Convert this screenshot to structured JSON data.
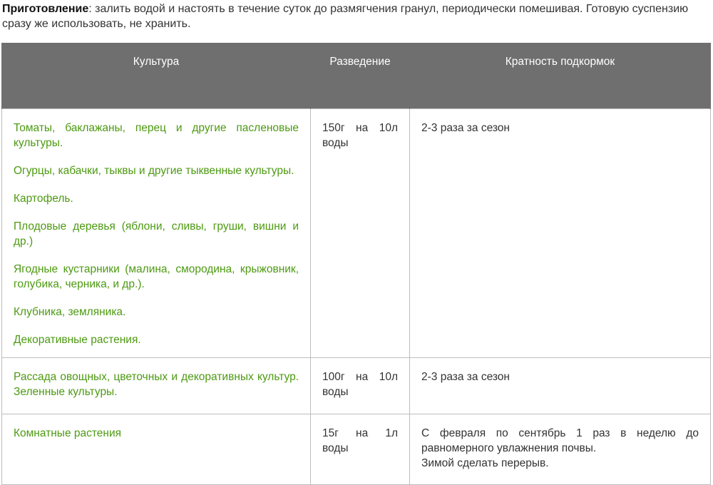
{
  "intro": {
    "bold": "Приготовление",
    "text": ": залить водой и настоять в течение суток до  размягчения гранул, периодически помешивая. Готовую суспензию сразу же использовать, не хранить."
  },
  "table": {
    "headers": [
      "Культура",
      "Разведение",
      "Кратность подкормок"
    ],
    "rows": [
      {
        "crops": [
          "Томаты, баклажаны, перец и другие пасленовые культуры.",
          "Огурцы, кабачки, тыквы и другие тыквенные культуры.",
          "Картофель.",
          "Плодовые деревья (яблони, сливы, груши, вишни и др.)",
          "Ягодные кустарники (малина, смородина, крыжовник, голубика, черника, и др.).",
          "Клубника, земляника.",
          "Декоративные растения."
        ],
        "dilution": "150г на 10л воды",
        "frequency": [
          "2-3 раза за сезон"
        ]
      },
      {
        "crops": [
          "Рассада овощных, цветочных и декоративных культур. Зеленные культуры."
        ],
        "dilution": "100г на 10л воды",
        "frequency": [
          "2-3 раза за сезон"
        ]
      },
      {
        "crops": [
          "Комнатные растения"
        ],
        "dilution": "15г на 1л воды",
        "frequency": [
          "С февраля по сентябрь 1 раз в неделю до равномерного увлажнения почвы.",
          "Зимой сделать перерыв."
        ]
      }
    ]
  },
  "colors": {
    "header_bg": "#6f6f6f",
    "crop_text": "#4d9a12",
    "body_text": "#333333",
    "border": "#bdbdbd"
  }
}
